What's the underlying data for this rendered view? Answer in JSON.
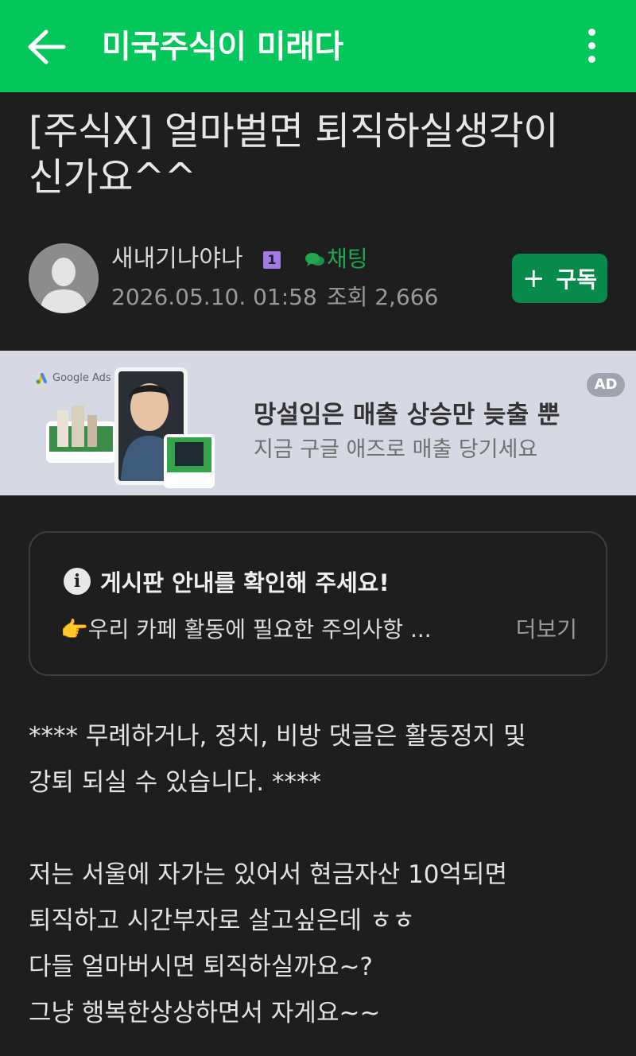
{
  "appbar": {
    "title": "미국주식이 미래다"
  },
  "post": {
    "title": "[주식X] 얼마벌면 퇴직하실생각이신가요^^",
    "author": "새내기나야나",
    "level": "1",
    "chat_label": "채팅",
    "date": "2026.05.10. 01:58",
    "views": "조회 2,666",
    "subscribe_label": "구독"
  },
  "ad": {
    "provider": "Google Ads",
    "headline": "망설임은 매출 상승만 늦출 뿐",
    "subtext": "지금 구글 애즈로 매출 당기세요",
    "badge": "AD"
  },
  "notice": {
    "heading": "게시판 안내를 확인해 주세요!",
    "body": "👉우리 카페 활동에 필요한 주의사항 ...",
    "more_label": "더보기"
  },
  "content": {
    "warning_line1": "**** 무례하거나, 정치, 비방 댓글은 활동정지 및",
    "warning_line2": "강퇴 되실 수 있습니다. ****",
    "line1": "저는 서울에 자가는 있어서 현금자산 10억되면",
    "line2": "퇴직하고 시간부자로 살고싶은데 ㅎㅎ",
    "line3": "다들 얼마버시면 퇴직하실까요~?",
    "line4": "그냥 행복한상상하면서 자게요~~"
  },
  "colors": {
    "brand": "#03c75a",
    "background": "#1e1e1e",
    "subscribe": "#078a4a"
  }
}
